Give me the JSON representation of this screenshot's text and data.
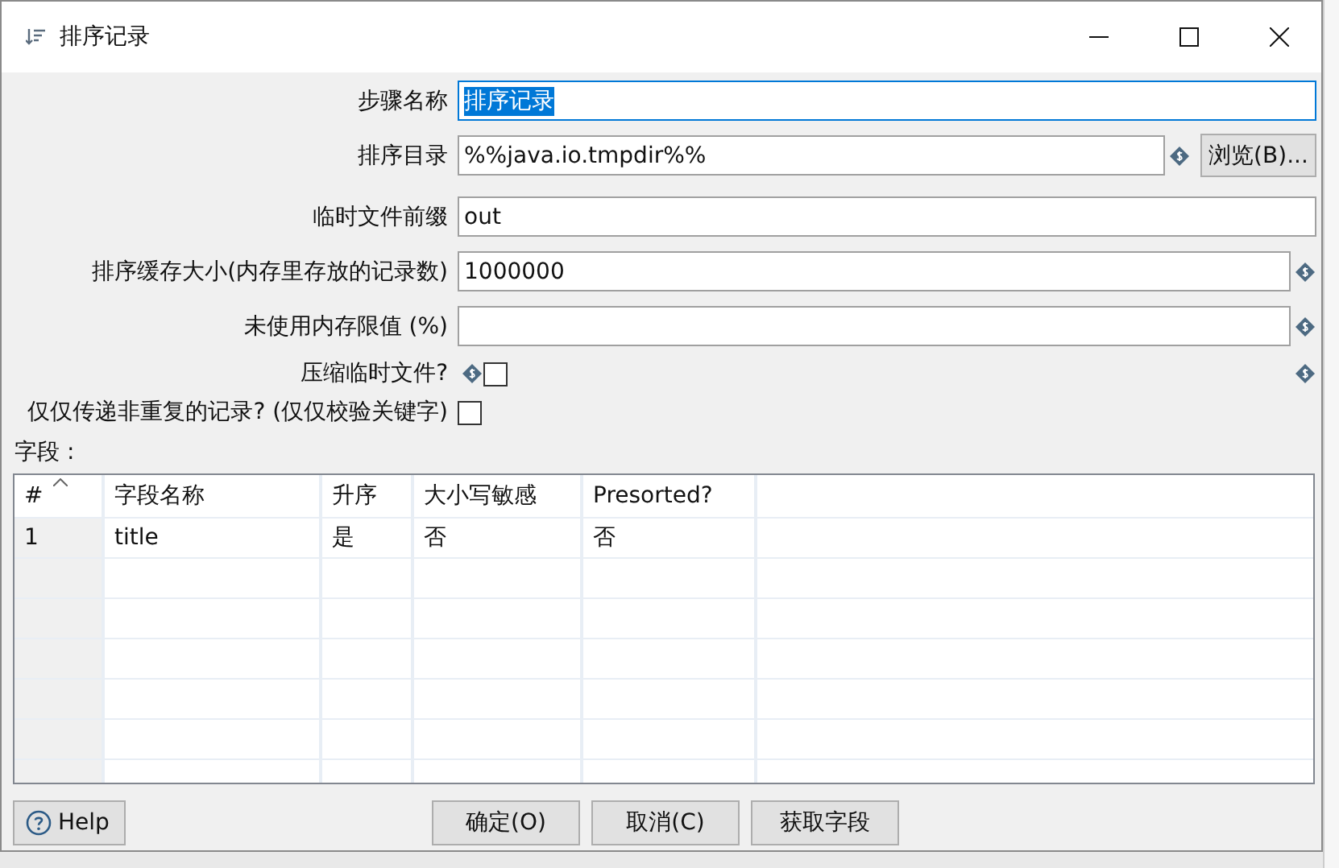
{
  "window": {
    "title": "排序记录"
  },
  "fields": [
    {
      "kind": "text",
      "label": "步骤名称",
      "value": "排序记录",
      "focused": true,
      "variable": false
    },
    {
      "kind": "browse",
      "label": "排序目录",
      "value": "%%java.io.tmpdir%%",
      "focused": false,
      "variable": true,
      "button": "浏览(B)..."
    },
    {
      "kind": "text",
      "label": "临时文件前缀",
      "value": "out",
      "focused": false,
      "variable": false
    },
    {
      "kind": "text",
      "label": "排序缓存大小(内存里存放的记录数)",
      "value": "1000000",
      "focused": false,
      "variable": true
    },
    {
      "kind": "text",
      "label": "未使用内存限值 (%)",
      "focused": false,
      "variable": true
    },
    {
      "kind": "checkbox",
      "label": "压缩临时文件?",
      "checked": false,
      "variable": true
    },
    {
      "kind": "checkbox",
      "label": "仅仅传递非重复的记录? (仅仅校验关键字)",
      "checked": false,
      "variable": false
    }
  ],
  "table": {
    "label": "字段 :",
    "columns": [
      {
        "label": "#",
        "sorted": true
      },
      {
        "label": "字段名称",
        "sorted": false
      },
      {
        "label": "升序",
        "sorted": false
      },
      {
        "label": "大小写敏感",
        "sorted": false
      },
      {
        "label": "Presorted?",
        "sorted": false
      }
    ],
    "rows": [
      [
        "1",
        "title",
        "是",
        "否",
        "否"
      ]
    ]
  },
  "buttons": {
    "help": "Help",
    "actions": [
      "确定(O)",
      "取消(C)",
      "获取字段"
    ]
  }
}
